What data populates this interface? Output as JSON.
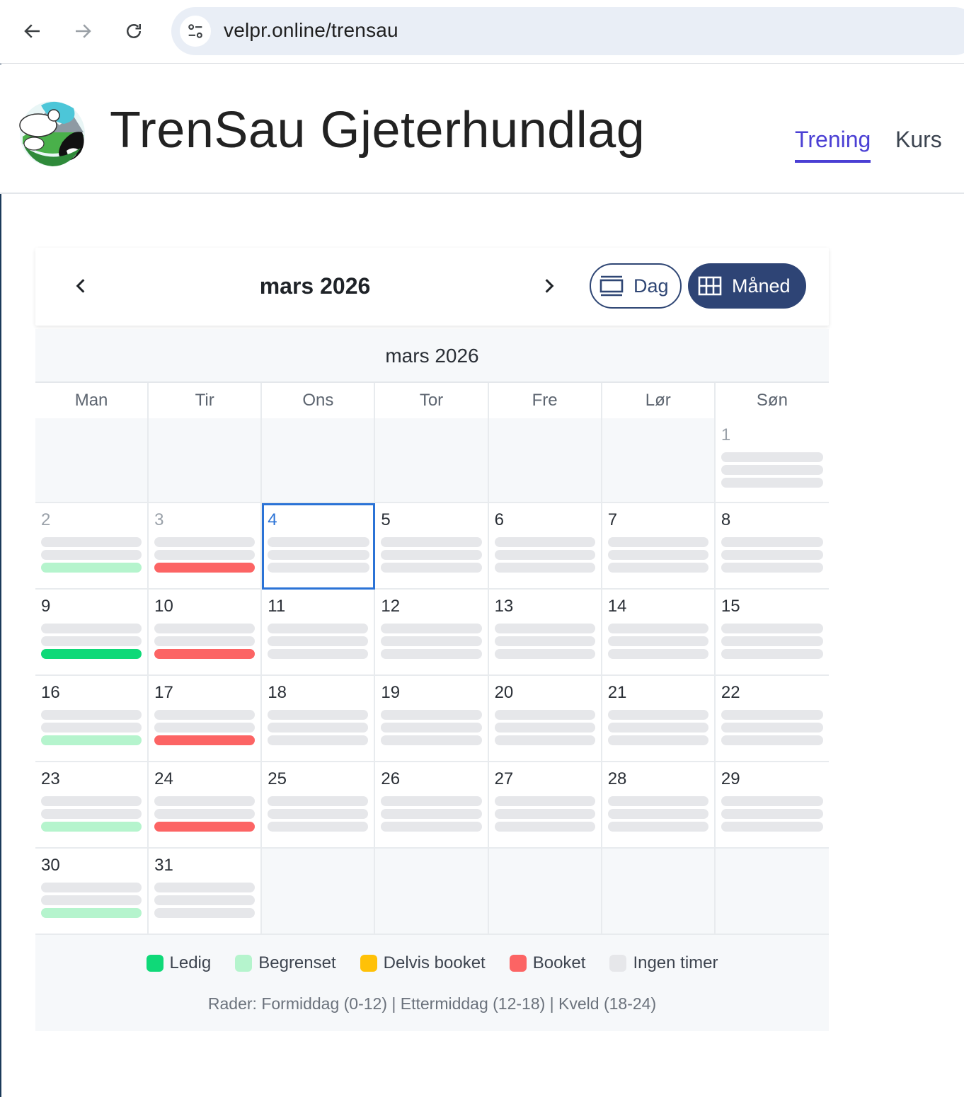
{
  "browser": {
    "url": "velpr.online/trensau"
  },
  "header": {
    "title": "TrenSau Gjeterhundlag",
    "nav": [
      {
        "label": "Trening",
        "active": true
      },
      {
        "label": "Kurs",
        "active": false
      }
    ]
  },
  "toolbar": {
    "title": "mars 2026",
    "views": [
      {
        "label": "Dag",
        "icon": "day-view-icon",
        "active": false
      },
      {
        "label": "Måned",
        "icon": "grid-icon",
        "active": true
      }
    ]
  },
  "calendar": {
    "month_label": "mars 2026",
    "weekdays": [
      "Man",
      "Tir",
      "Ons",
      "Tor",
      "Fre",
      "Lør",
      "Søn"
    ],
    "leading_blank_days": 6,
    "today": 4,
    "past_days": [
      1,
      2,
      3
    ],
    "days": [
      {
        "n": "1",
        "slots": [
          "none",
          "none",
          "none"
        ]
      },
      {
        "n": "2",
        "slots": [
          "none",
          "none",
          "begrenset"
        ]
      },
      {
        "n": "3",
        "slots": [
          "none",
          "none",
          "booket"
        ]
      },
      {
        "n": "4",
        "slots": [
          "none",
          "none",
          "none"
        ]
      },
      {
        "n": "5",
        "slots": [
          "none",
          "none",
          "none"
        ]
      },
      {
        "n": "6",
        "slots": [
          "none",
          "none",
          "none"
        ]
      },
      {
        "n": "7",
        "slots": [
          "none",
          "none",
          "none"
        ]
      },
      {
        "n": "8",
        "slots": [
          "none",
          "none",
          "none"
        ]
      },
      {
        "n": "9",
        "slots": [
          "none",
          "none",
          "ledig"
        ]
      },
      {
        "n": "10",
        "slots": [
          "none",
          "none",
          "booket"
        ]
      },
      {
        "n": "11",
        "slots": [
          "none",
          "none",
          "none"
        ]
      },
      {
        "n": "12",
        "slots": [
          "none",
          "none",
          "none"
        ]
      },
      {
        "n": "13",
        "slots": [
          "none",
          "none",
          "none"
        ]
      },
      {
        "n": "14",
        "slots": [
          "none",
          "none",
          "none"
        ]
      },
      {
        "n": "15",
        "slots": [
          "none",
          "none",
          "none"
        ]
      },
      {
        "n": "16",
        "slots": [
          "none",
          "none",
          "begrenset"
        ]
      },
      {
        "n": "17",
        "slots": [
          "none",
          "none",
          "booket"
        ]
      },
      {
        "n": "18",
        "slots": [
          "none",
          "none",
          "none"
        ]
      },
      {
        "n": "19",
        "slots": [
          "none",
          "none",
          "none"
        ]
      },
      {
        "n": "20",
        "slots": [
          "none",
          "none",
          "none"
        ]
      },
      {
        "n": "21",
        "slots": [
          "none",
          "none",
          "none"
        ]
      },
      {
        "n": "22",
        "slots": [
          "none",
          "none",
          "none"
        ]
      },
      {
        "n": "23",
        "slots": [
          "none",
          "none",
          "begrenset"
        ]
      },
      {
        "n": "24",
        "slots": [
          "none",
          "none",
          "booket"
        ]
      },
      {
        "n": "25",
        "slots": [
          "none",
          "none",
          "none"
        ]
      },
      {
        "n": "26",
        "slots": [
          "none",
          "none",
          "none"
        ]
      },
      {
        "n": "27",
        "slots": [
          "none",
          "none",
          "none"
        ]
      },
      {
        "n": "28",
        "slots": [
          "none",
          "none",
          "none"
        ]
      },
      {
        "n": "29",
        "slots": [
          "none",
          "none",
          "none"
        ]
      },
      {
        "n": "30",
        "slots": [
          "none",
          "none",
          "begrenset"
        ]
      },
      {
        "n": "31",
        "slots": [
          "none",
          "none",
          "none"
        ]
      }
    ],
    "trailing_blank_days": 5
  },
  "legend": {
    "items": [
      {
        "label": "Ledig",
        "color": "#0fd978"
      },
      {
        "label": "Begrenset",
        "color": "#b5f4cd"
      },
      {
        "label": "Delvis booket",
        "color": "#ffc107"
      },
      {
        "label": "Booket",
        "color": "#fc6464"
      },
      {
        "label": "Ingen timer",
        "color": "#e6e7ea"
      }
    ],
    "note": "Rader: Formiddag (0-12) | Ettermiddag (12-18) | Kveld (18-24)"
  }
}
